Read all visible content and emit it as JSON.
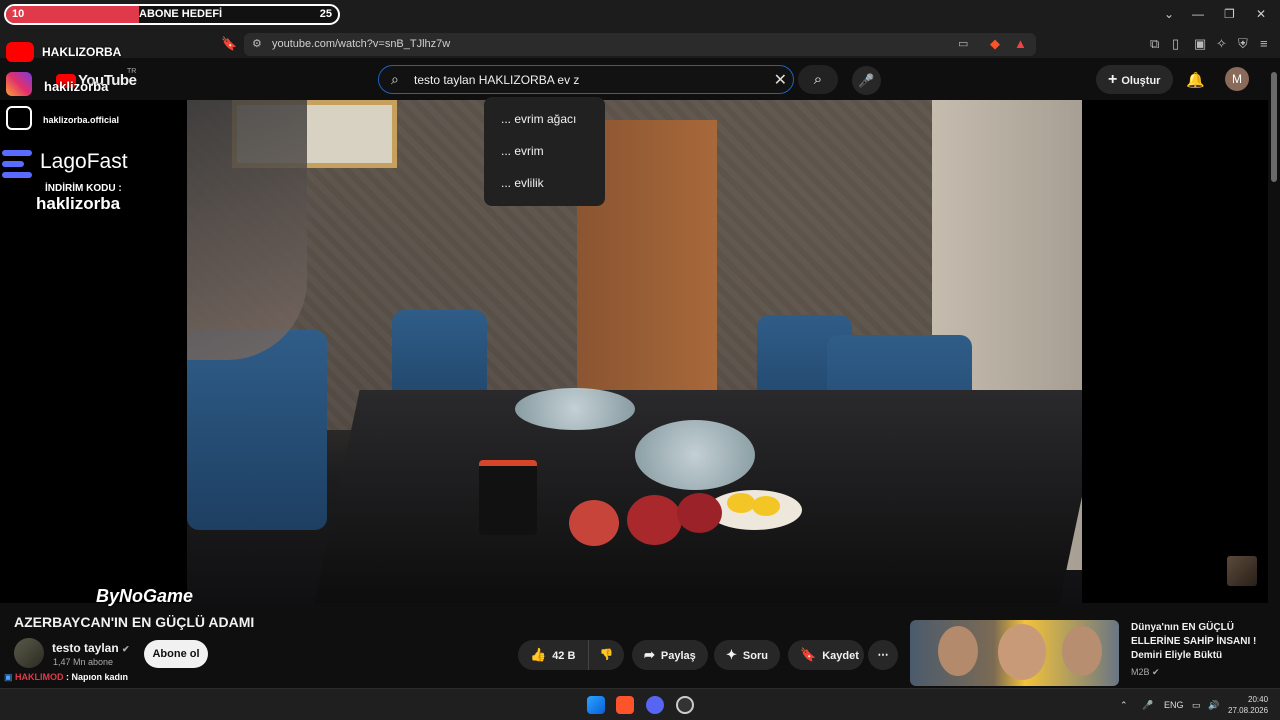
{
  "sub_goal": {
    "current": "10",
    "label": "ABONE HEDEFİ",
    "target": "25",
    "progress": 0.4
  },
  "browser": {
    "url": "youtube.com/watch?v=snB_TJlhz7w"
  },
  "overlay": {
    "youtube_handle": "HAKLIZORBA",
    "instagram_handle": "haklizorba",
    "tiktok_handle": "haklizorba.official",
    "sponsor": "LagoFast",
    "discount_label": "İNDİRİM KODU :",
    "discount_code": "haklizorba",
    "bynogame": "ByNoGame"
  },
  "youtube": {
    "logo": "YouTube",
    "region": "TR",
    "search_query": "testo taylan HAKLIZORBA ev z",
    "suggestions": [
      "... evrim ağacı",
      "... evrim",
      "... evlilik"
    ],
    "create_label": "Oluştur",
    "avatar_letter": "M"
  },
  "video": {
    "title": "AZERBAYCAN'IN EN GÜÇLÜ ADAMI",
    "channel": "testo taylan",
    "subscribers": "1,47 Mn abone",
    "subscribe_label": "Abone ol",
    "likes": "42 B",
    "share_label": "Paylaş",
    "ask_label": "Soru",
    "save_label": "Kaydet"
  },
  "recommendation": {
    "title": "Dünya'nın EN GÜÇLÜ ELLERİNE SAHİP İNSANI ! Demiri Eliyle Büktü",
    "channel": "M2B"
  },
  "chat": {
    "user": "HAKLIMOD",
    "message": ": Napıon kadın"
  },
  "taskbar": {
    "lang": "ENG",
    "time": "20:40",
    "date": "27.08.2026"
  },
  "colors": {
    "accent_red": "#e0394a",
    "search_border": "#1c62b9",
    "youtube_red": "#ff0000"
  }
}
